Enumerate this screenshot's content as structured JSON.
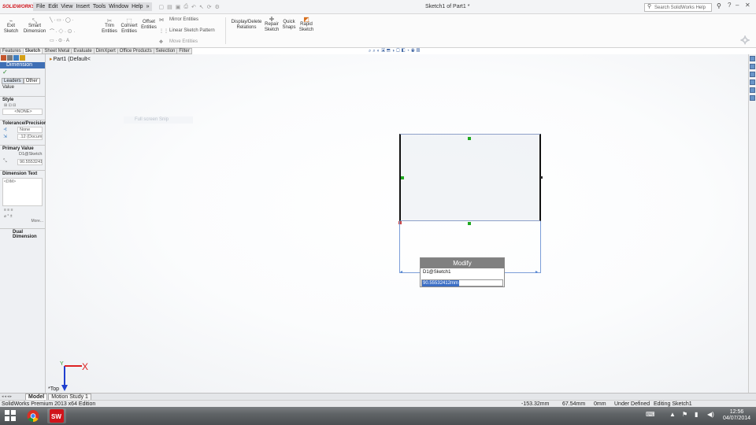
{
  "app": {
    "logo": "SOLIDWORKS",
    "window_title": "Sketch1 of Part1 *",
    "menu": [
      "File",
      "Edit",
      "View",
      "Insert",
      "Tools",
      "Window",
      "Help"
    ],
    "search_placeholder": "Search SolidWorks Help"
  },
  "ribbon": {
    "exit_sketch": "Exit Sketch",
    "smart_dimension": "Smart Dimension",
    "trim_entities": "Trim Entities",
    "convert_entities": "Convert Entities",
    "offset_entities": "Offset Entities",
    "mirror_entities": "Mirror Entities",
    "linear_sketch_pattern": "Linear Sketch Pattern",
    "move_entities": "Move Entities",
    "display_delete_relations": "Display/Delete Relations",
    "repair_sketch": "Repair Sketch",
    "quick_snaps": "Quick Snaps",
    "rapid_sketch": "Rapid Sketch"
  },
  "command_tabs": [
    "Features",
    "Sketch",
    "Sheet Metal",
    "Evaluate",
    "DimXpert",
    "Office Products",
    "Selection",
    "Filter"
  ],
  "active_command_tab": "Sketch",
  "property_manager": {
    "title": "Dimension",
    "tabs": [
      "Leaders",
      "Other"
    ],
    "value_tab": "Value",
    "style_label": "Style",
    "style_value": "<NONE>",
    "tolerance_label": "Tolerance/Precision",
    "tolerance_type": "None",
    "precision": ".12 (Document)",
    "primary_value_label": "Primary Value",
    "primary_value_name": "D1@Sketch1",
    "primary_value_number": "90.55532412",
    "dimension_text_label": "Dimension Text",
    "dimension_text_value": "<DIM>",
    "more_label": "More...",
    "dual_dimension_label": "Dual Dimension"
  },
  "graphics": {
    "tree_root": "Part1  (Default<",
    "fullscreen_hint": "Full screen Snip",
    "view_label": "*Top"
  },
  "modify_dialog": {
    "title": "Modify",
    "dimension_name": "D1@Sketch1",
    "value": "90.55532412mm"
  },
  "bottom_tabs": [
    "Model",
    "Motion Study 1"
  ],
  "status": {
    "edition": "SolidWorks Premium 2013 x64 Edition",
    "x": "-153.32mm",
    "y": "67.54mm",
    "z": "0mm",
    "state": "Under Defined",
    "mode": "Editing Sketch1"
  },
  "taskbar": {
    "time": "12:56",
    "date": "04/07/2014"
  },
  "colors": {
    "pm_title": "#3f6fb5",
    "selection": "#3b6ec5",
    "handle": "#1fa81f",
    "dim_line": "#7c9ed8"
  }
}
